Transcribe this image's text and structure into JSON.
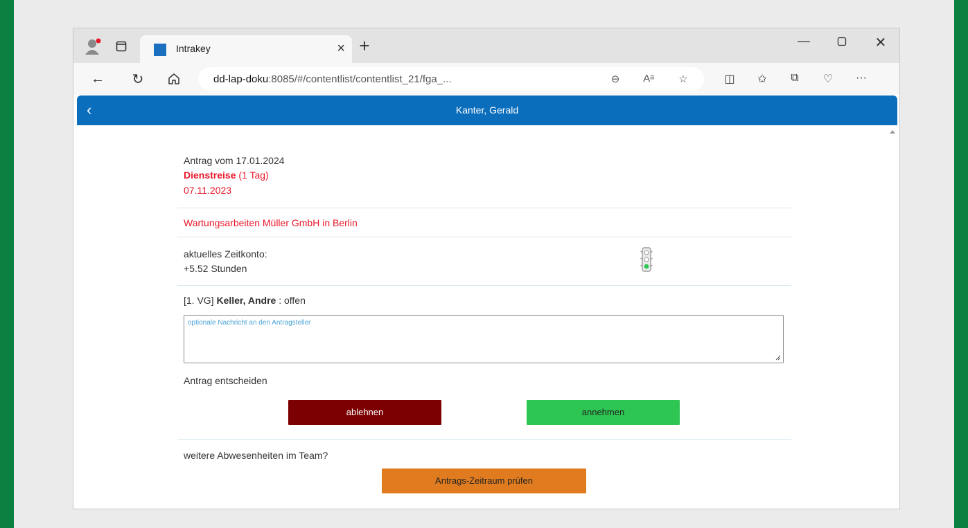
{
  "browser": {
    "tab_title": "Intrakey",
    "url_host": "dd-lap-doku",
    "url_rest": ":8085/#/contentlist/contentlist_21/fga_...",
    "reading_aloud_label": "Aᵃ"
  },
  "app": {
    "header_title": "Kanter, Gerald"
  },
  "request": {
    "date_line": "Antrag vom 17.01.2024",
    "type": "Dienstreise",
    "duration": " (1 Tag)",
    "period": "07.11.2023",
    "reason": "Wartungsarbeiten Müller GmbH in Berlin",
    "time_account_label": "aktuelles Zeitkonto:",
    "time_account_value": "+5.52 Stunden"
  },
  "approver": {
    "level": "[1. VG] ",
    "name": "Keller, Andre",
    "status": " : offen"
  },
  "message": {
    "placeholder": "optionale Nachricht an den Antragsteller"
  },
  "decision": {
    "label": "Antrag entscheiden",
    "reject_label": "ablehnen",
    "accept_label": "annehmen"
  },
  "team": {
    "label": "weitere Abwesenheiten im Team?",
    "check_label": "Antrags-Zeitraum prüfen"
  },
  "colors": {
    "header": "#0a6ebd",
    "reject": "#7c0002",
    "accept": "#2dc653",
    "check": "#e07c1f",
    "highlight": "#e8182a"
  },
  "icons": [
    "profile-icon",
    "tab-actions-icon",
    "back-icon",
    "refresh-icon",
    "home-icon",
    "zoom-icon",
    "read-aloud-icon",
    "favorite-icon",
    "split-screen-icon",
    "favorites-icon",
    "collections-icon",
    "health-icon",
    "more-icon",
    "traffic-light-icon"
  ]
}
